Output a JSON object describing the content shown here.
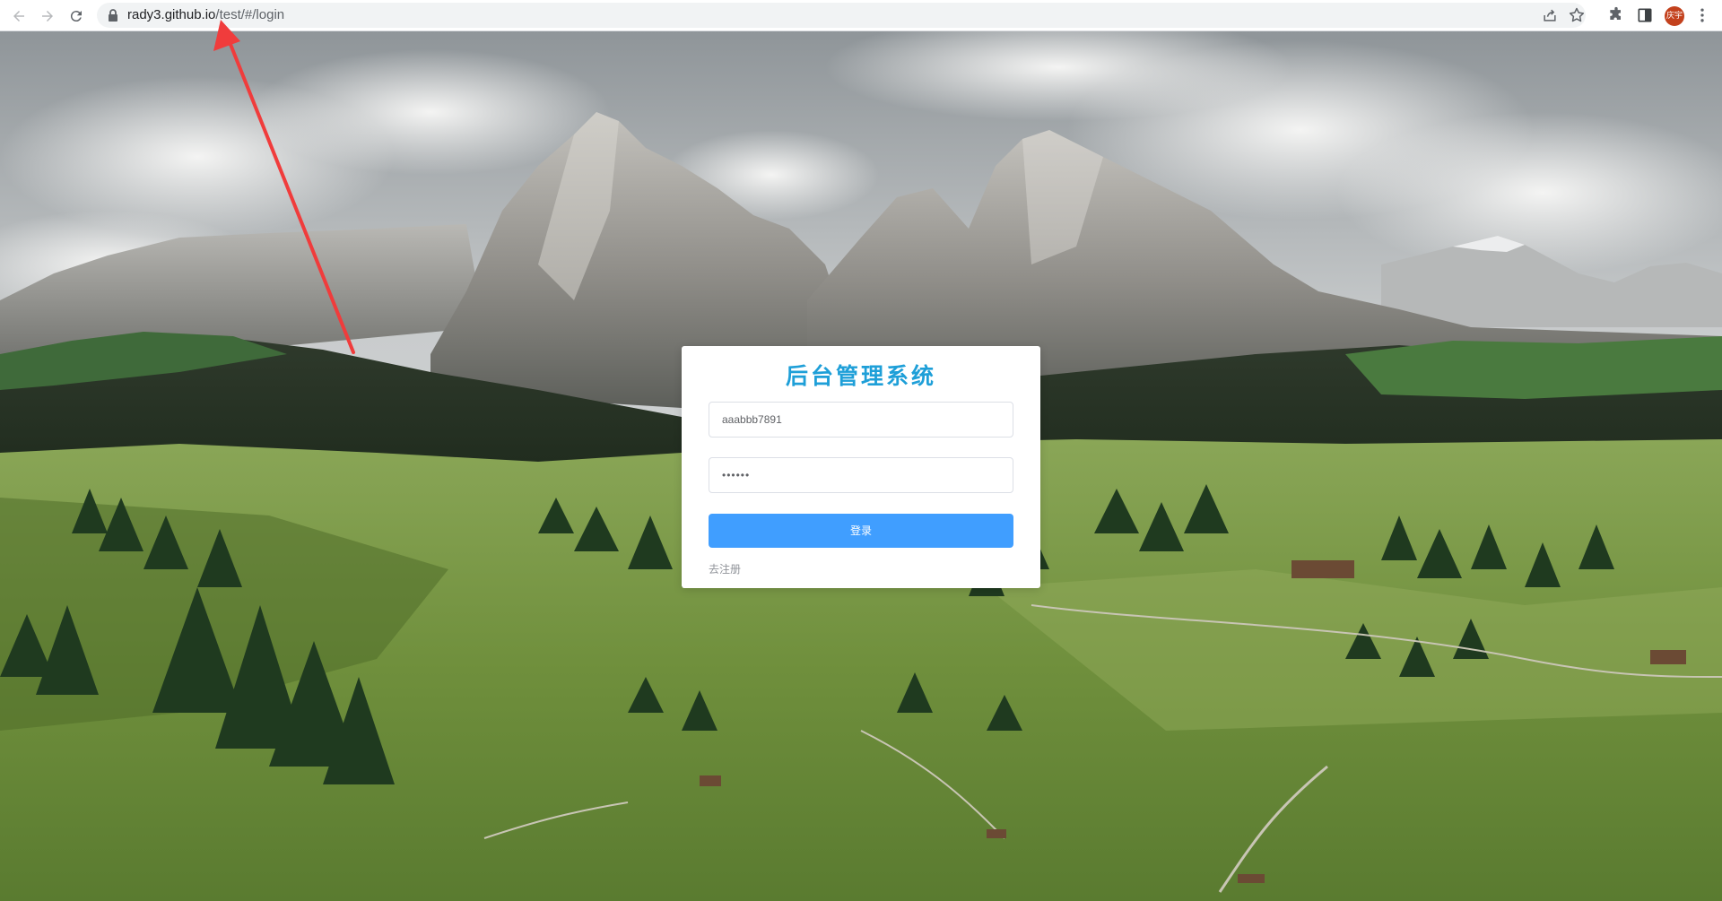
{
  "browser": {
    "url_host": "rady3.github.io",
    "url_path": "/test/#/login",
    "profile_label": "庆宇",
    "icons": {
      "back": "back-arrow-icon",
      "forward": "forward-arrow-icon",
      "reload": "reload-icon",
      "lock": "lock-icon",
      "share": "share-icon",
      "bookmark": "star-icon",
      "extensions": "puzzle-icon",
      "side_panel": "side-panel-icon",
      "menu": "kebab-menu-icon"
    }
  },
  "login": {
    "title": "后台管理系统",
    "username_value": "aaabbb7891",
    "password_value": "••••••",
    "login_button": "登录",
    "register_link": "去注册"
  },
  "colors": {
    "title": "#1e9fd8",
    "primary_button": "#409eff",
    "annotation_arrow": "#f03c3c"
  }
}
